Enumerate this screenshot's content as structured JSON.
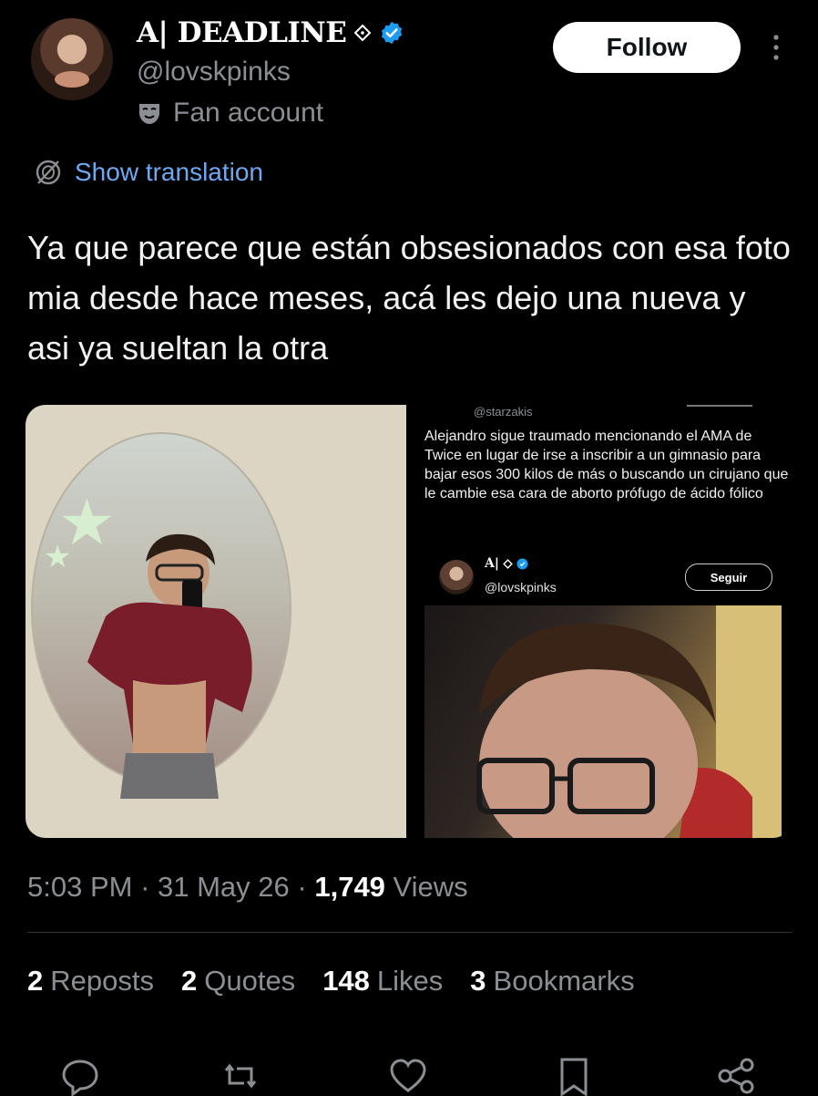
{
  "author": {
    "display_name": "A| DEADLINE",
    "handle": "@lovskpinks",
    "label": "Fan account",
    "follow_label": "Follow"
  },
  "translation": {
    "label": "Show translation"
  },
  "tweet": {
    "text": "Ya que parece que están obsesionados con esa foto mia desde hace meses, acá les dejo una nueva y asi ya sueltan la otra"
  },
  "media": {
    "quoted": {
      "top_handle": "@starzakis",
      "text": "Alejandro sigue traumado mencionando el AMA de Twice en lugar de irse a inscribir a un gimnasio para bajar esos 300 kilos de más o buscando un cirujano que le cambie esa cara de aborto prófugo de ácido fólico",
      "name": "A|",
      "handle": "@lovskpinks",
      "follow_label": "Seguir"
    }
  },
  "meta": {
    "time": "5:03 PM",
    "date": "31 May 26",
    "views_count": "1,749",
    "views_label": "Views"
  },
  "stats": {
    "reposts": {
      "count": "2",
      "label": "Reposts"
    },
    "quotes": {
      "count": "2",
      "label": "Quotes"
    },
    "likes": {
      "count": "148",
      "label": "Likes"
    },
    "bookmarks": {
      "count": "3",
      "label": "Bookmarks"
    }
  },
  "icons": [
    "diamond-icon",
    "verified-icon",
    "mask-icon",
    "more-icon",
    "translate-icon",
    "reply-icon",
    "repost-icon",
    "like-icon",
    "bookmark-icon",
    "share-icon"
  ],
  "colors": {
    "background": "#000000",
    "link": "#6ea8f0",
    "verified": "#1d9bf0",
    "muted": "#8b8f94"
  }
}
